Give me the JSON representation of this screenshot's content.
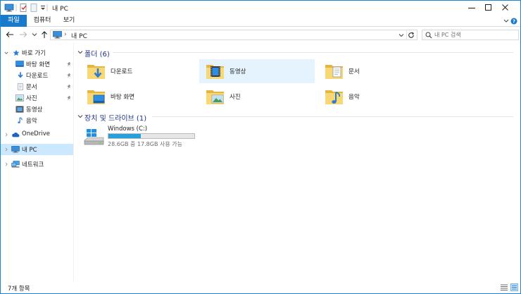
{
  "window": {
    "title": "내 PC",
    "accent": "#1979ca",
    "border": "#1883d7"
  },
  "ribbon": {
    "tabs": [
      {
        "label": "파일",
        "active": true
      },
      {
        "label": "컴퓨터",
        "active": false
      },
      {
        "label": "보기",
        "active": false
      }
    ]
  },
  "address": {
    "breadcrumb": "내 PC",
    "search_placeholder": "내 PC 검색"
  },
  "nav": {
    "quick_access": "바로 가기",
    "quick_items": [
      {
        "label": "바탕 화면",
        "icon": "desktop-icon",
        "pinned": true
      },
      {
        "label": "다운로드",
        "icon": "download-icon",
        "pinned": true
      },
      {
        "label": "문서",
        "icon": "document-icon",
        "pinned": true
      },
      {
        "label": "사진",
        "icon": "pictures-icon",
        "pinned": true
      },
      {
        "label": "동영상",
        "icon": "video-icon",
        "pinned": false
      },
      {
        "label": "음악",
        "icon": "music-icon",
        "pinned": false
      }
    ],
    "onedrive": "OneDrive",
    "this_pc": "내 PC",
    "network": "네트워크"
  },
  "content": {
    "folders_title": "폴더 (6)",
    "folders": [
      {
        "label": "다운로드",
        "icon": "download-folder-icon"
      },
      {
        "label": "동영상",
        "icon": "video-folder-icon"
      },
      {
        "label": "문서",
        "icon": "documents-folder-icon"
      },
      {
        "label": "바탕 화면",
        "icon": "desktop-folder-icon"
      },
      {
        "label": "사진",
        "icon": "pictures-folder-icon"
      },
      {
        "label": "음악",
        "icon": "music-folder-icon"
      }
    ],
    "devices_title": "장치 및 드라이브 (1)",
    "drives": [
      {
        "name": "Windows (C:)",
        "free": "28.6GB 중 17.8GB 사용 가능",
        "used_fraction": 0.378,
        "icon": "windows-drive-icon"
      }
    ]
  },
  "status": {
    "count": "7개 항목"
  }
}
